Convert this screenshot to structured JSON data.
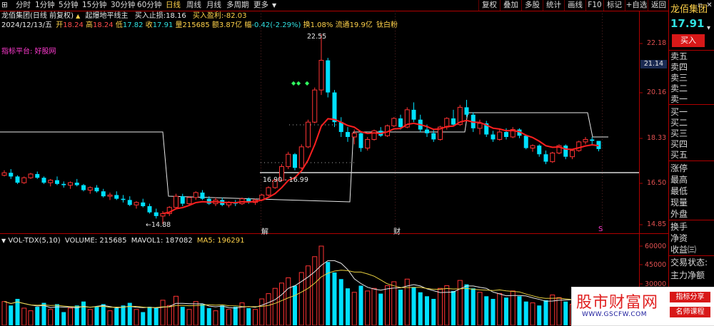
{
  "toolbar": {
    "items": [
      {
        "label": "分时"
      },
      {
        "label": "1分钟"
      },
      {
        "label": "5分钟"
      },
      {
        "label": "15分钟"
      },
      {
        "label": "30分钟"
      },
      {
        "label": "60分钟"
      },
      {
        "label": "日线"
      },
      {
        "label": "周线"
      },
      {
        "label": "月线"
      },
      {
        "label": "多周期"
      },
      {
        "label": "更多"
      }
    ],
    "active_index": 6,
    "right_buttons": [
      {
        "label": "复权"
      },
      {
        "label": "叠加"
      },
      {
        "label": "多股"
      },
      {
        "label": "统计"
      },
      {
        "label": "画线"
      },
      {
        "label": "F10"
      },
      {
        "label": "标记"
      },
      {
        "label": "+自选"
      },
      {
        "label": "返回"
      }
    ]
  },
  "stock": {
    "title": "龙佰集团(日线 前复权)",
    "indicator_name": "起爆地平线主",
    "stop_label": "买入止损:",
    "stop_value": "18.16",
    "profit_label": "买入盈利:",
    "profit_value": "-82.03"
  },
  "quote_line": {
    "date": "2024/12/13/五",
    "open_label": "开",
    "open": "18.24",
    "high_label": "高",
    "high": "18.24",
    "low_label": "低",
    "low": "17.82",
    "close_label": "收",
    "close": "17.91",
    "vol_label": "量",
    "vol": "215685",
    "amount_label": "额",
    "amount": "3.87亿",
    "change_label": "幅",
    "change": "-0.42(-2.29%)",
    "turnover_label": "换",
    "turnover": "1.08%",
    "float_label": "流通",
    "float": "19.9亿",
    "tag": "钛白粉"
  },
  "platform_text": "指标平台: 好股网",
  "volume_header": {
    "name": "VOL-TDX(5,10)",
    "volume": "VOLUME: 215685",
    "mavol1": "MAVOL1: 187082",
    "ma5": "MA5: 196291"
  },
  "price_axis": [
    "22.18",
    "20.16",
    "18.33",
    "16.50",
    "14.85"
  ],
  "price_marker": "21.14",
  "volume_axis": [
    "60000",
    "45000",
    "30000"
  ],
  "annotations": {
    "high": "22.55",
    "low": "←14.88",
    "range": "16.90 - 16.99",
    "jie": "解",
    "cai": "财",
    "s": "S"
  },
  "right_panel": {
    "name": "龙佰集团",
    "price": "17.91",
    "buy_button": "买入",
    "order_labels": [
      "卖五",
      "卖四",
      "卖三",
      "卖二",
      "卖一",
      "买一",
      "买二",
      "买三",
      "买四",
      "买五"
    ],
    "stat_labels": [
      "涨停",
      "最高",
      "最低",
      "现量",
      "外盘",
      "换手",
      "净资",
      "收益㈢",
      "交易状态:",
      "主力净额"
    ]
  },
  "watermark": {
    "site": "股市财富网",
    "url": "WWW.GSCFW.COM",
    "tag1": "指标分享",
    "tag2": "名师课程"
  },
  "colors": {
    "up": "#ff3333",
    "down": "#00e0ff",
    "mainline": "#ff2020",
    "stepline": "#e8e8e8",
    "border": "#b00000",
    "axis_text": "#e05050"
  },
  "chart_data": {
    "type": "candlestick",
    "ohlc": [
      [
        16.85,
        17.05,
        16.8,
        16.95
      ],
      [
        16.95,
        17.1,
        16.7,
        16.8
      ],
      [
        16.8,
        16.85,
        16.5,
        16.55
      ],
      [
        16.55,
        16.8,
        16.5,
        16.75
      ],
      [
        16.75,
        16.95,
        16.7,
        16.9
      ],
      [
        16.9,
        17.0,
        16.7,
        16.75
      ],
      [
        16.75,
        16.8,
        16.5,
        16.55
      ],
      [
        16.55,
        16.7,
        16.4,
        16.65
      ],
      [
        16.65,
        16.8,
        16.45,
        16.5
      ],
      [
        16.5,
        16.6,
        16.35,
        16.45
      ],
      [
        16.45,
        16.6,
        16.3,
        16.55
      ],
      [
        16.55,
        16.7,
        16.4,
        16.45
      ],
      [
        16.45,
        16.5,
        16.2,
        16.25
      ],
      [
        16.25,
        16.4,
        16.1,
        16.35
      ],
      [
        16.35,
        16.45,
        16.15,
        16.2
      ],
      [
        16.2,
        16.3,
        15.95,
        16.0
      ],
      [
        16.0,
        16.15,
        15.85,
        16.05
      ],
      [
        16.05,
        16.2,
        15.85,
        15.9
      ],
      [
        15.9,
        16.05,
        15.75,
        15.85
      ],
      [
        15.85,
        16.0,
        15.6,
        15.65
      ],
      [
        15.65,
        15.8,
        15.5,
        15.75
      ],
      [
        15.75,
        15.9,
        15.55,
        15.6
      ],
      [
        15.6,
        15.7,
        15.3,
        15.35
      ],
      [
        15.35,
        15.5,
        15.1,
        15.2
      ],
      [
        15.2,
        15.4,
        14.88,
        15.3
      ],
      [
        15.3,
        15.6,
        15.2,
        15.55
      ],
      [
        15.55,
        16.1,
        15.5,
        16.0
      ],
      [
        16.0,
        16.1,
        15.6,
        15.7
      ],
      [
        15.7,
        16.0,
        15.6,
        15.95
      ],
      [
        15.95,
        16.2,
        15.85,
        16.15
      ],
      [
        16.15,
        16.25,
        15.85,
        15.9
      ],
      [
        15.9,
        16.0,
        15.65,
        15.7
      ],
      [
        15.7,
        15.95,
        15.6,
        15.85
      ],
      [
        15.85,
        15.95,
        15.6,
        15.65
      ],
      [
        15.65,
        15.8,
        15.55,
        15.75
      ],
      [
        15.75,
        15.85,
        15.6,
        15.7
      ],
      [
        15.7,
        15.95,
        15.65,
        15.9
      ],
      [
        15.9,
        15.95,
        15.7,
        15.75
      ],
      [
        15.75,
        15.9,
        15.65,
        15.85
      ],
      [
        15.85,
        16.1,
        15.8,
        16.05
      ],
      [
        16.05,
        16.4,
        16.0,
        16.35
      ],
      [
        16.35,
        16.7,
        16.3,
        16.65
      ],
      [
        16.65,
        17.3,
        16.6,
        17.2
      ],
      [
        17.2,
        17.8,
        17.1,
        17.7
      ],
      [
        17.7,
        17.75,
        17.05,
        17.15
      ],
      [
        17.15,
        18.1,
        17.1,
        18.0
      ],
      [
        18.0,
        19.1,
        17.95,
        19.0
      ],
      [
        19.0,
        20.4,
        18.95,
        20.3
      ],
      [
        20.3,
        22.55,
        20.1,
        21.5
      ],
      [
        21.5,
        21.6,
        20.0,
        20.2
      ],
      [
        20.2,
        20.3,
        18.8,
        19.0
      ],
      [
        19.0,
        19.2,
        18.4,
        18.6
      ],
      [
        18.6,
        18.8,
        18.2,
        18.4
      ],
      [
        18.4,
        18.7,
        18.1,
        18.55
      ],
      [
        18.55,
        18.6,
        17.8,
        17.95
      ],
      [
        17.95,
        18.4,
        17.85,
        18.3
      ],
      [
        18.3,
        18.7,
        18.25,
        18.65
      ],
      [
        18.65,
        18.8,
        18.4,
        18.45
      ],
      [
        18.45,
        18.9,
        18.4,
        18.85
      ],
      [
        18.85,
        19.2,
        18.8,
        19.15
      ],
      [
        19.15,
        19.3,
        18.7,
        18.8
      ],
      [
        18.8,
        19.6,
        18.75,
        19.5
      ],
      [
        19.5,
        19.8,
        19.0,
        19.1
      ],
      [
        19.1,
        19.3,
        18.6,
        18.7
      ],
      [
        18.7,
        18.9,
        18.4,
        18.55
      ],
      [
        18.55,
        18.7,
        18.2,
        18.3
      ],
      [
        18.3,
        18.85,
        18.25,
        18.8
      ],
      [
        18.8,
        19.2,
        18.7,
        19.15
      ],
      [
        19.15,
        19.5,
        18.85,
        18.9
      ],
      [
        18.9,
        19.7,
        18.85,
        19.6
      ],
      [
        19.6,
        19.9,
        19.2,
        19.3
      ],
      [
        19.3,
        19.4,
        18.6,
        18.75
      ],
      [
        18.75,
        19.1,
        18.5,
        18.95
      ],
      [
        18.95,
        19.05,
        18.4,
        18.5
      ],
      [
        18.5,
        18.65,
        18.2,
        18.3
      ],
      [
        18.3,
        18.7,
        18.25,
        18.6
      ],
      [
        18.6,
        18.75,
        18.3,
        18.4
      ],
      [
        18.4,
        18.8,
        18.35,
        18.7
      ],
      [
        18.7,
        18.75,
        18.35,
        18.45
      ],
      [
        18.45,
        18.5,
        17.9,
        17.95
      ],
      [
        17.95,
        18.1,
        17.8,
        18.05
      ],
      [
        18.05,
        18.1,
        17.6,
        17.7
      ],
      [
        17.7,
        17.85,
        17.3,
        17.4
      ],
      [
        17.4,
        17.8,
        17.35,
        17.75
      ],
      [
        17.75,
        18.1,
        17.7,
        18.05
      ],
      [
        18.05,
        18.1,
        17.5,
        17.6
      ],
      [
        17.6,
        17.9,
        17.5,
        17.85
      ],
      [
        17.85,
        18.25,
        17.8,
        18.2
      ],
      [
        18.2,
        18.4,
        18.1,
        18.3
      ],
      [
        18.3,
        18.4,
        18.05,
        18.24
      ],
      [
        18.24,
        18.24,
        17.82,
        17.91
      ]
    ],
    "volume": [
      18,
      15,
      20,
      13,
      11,
      14,
      17,
      12,
      16,
      10,
      13,
      15,
      18,
      12,
      14,
      16,
      11,
      13,
      15,
      17,
      12,
      10,
      14,
      13,
      19,
      15,
      22,
      14,
      12,
      18,
      16,
      13,
      11,
      15,
      12,
      14,
      17,
      13,
      12,
      20,
      24,
      28,
      32,
      36,
      30,
      40,
      45,
      52,
      60,
      48,
      40,
      35,
      28,
      25,
      30,
      26,
      28,
      24,
      30,
      33,
      27,
      35,
      29,
      25,
      22,
      20,
      28,
      30,
      26,
      34,
      31,
      28,
      25,
      22,
      20,
      24,
      21,
      26,
      22,
      18,
      17,
      15,
      19,
      23,
      21,
      18,
      16,
      20,
      22,
      25,
      21
    ],
    "xlabel": "",
    "ylabel": ""
  }
}
